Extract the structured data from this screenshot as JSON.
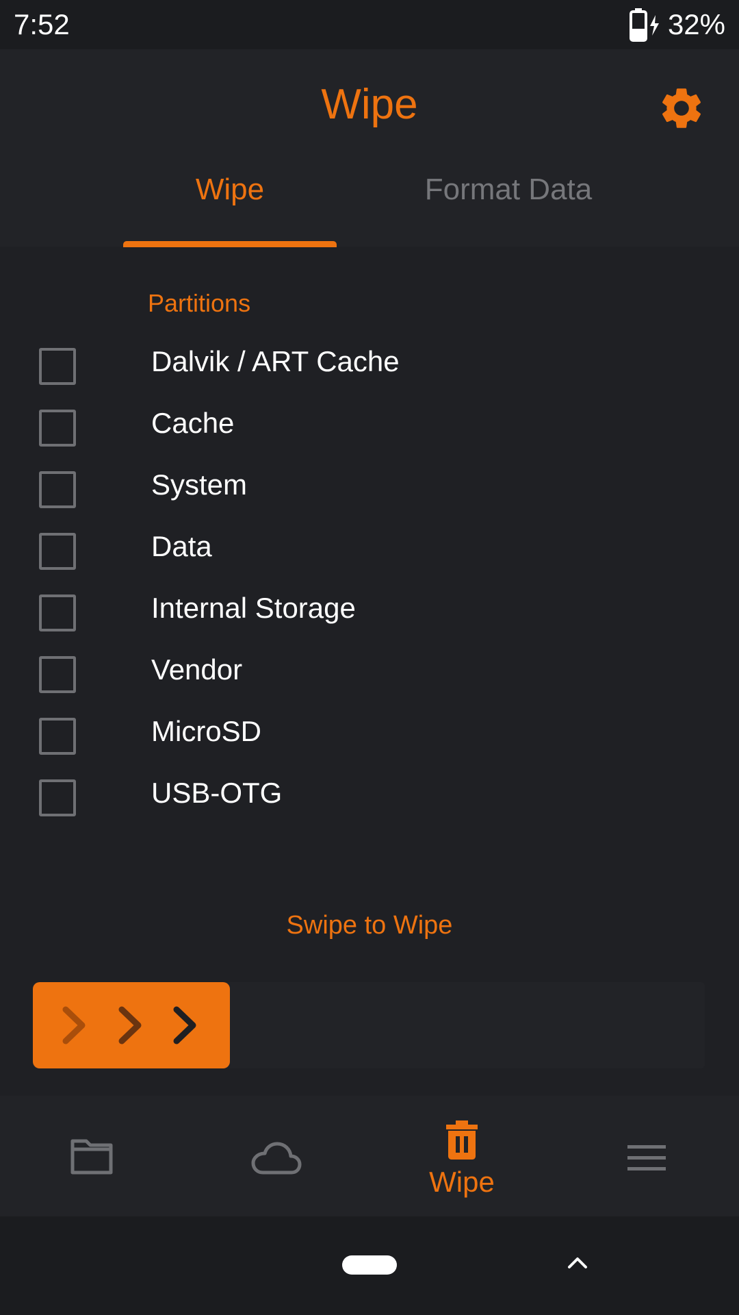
{
  "status_bar": {
    "time": "7:52",
    "battery_percent": "32%",
    "battery_icon": "battery-charging-icon"
  },
  "header": {
    "title": "Wipe",
    "settings_icon": "gear-icon"
  },
  "tabs": [
    {
      "label": "Wipe",
      "active": true
    },
    {
      "label": "Format Data",
      "active": false
    }
  ],
  "partitions": {
    "section_label": "Partitions",
    "items": [
      {
        "label": "Dalvik / ART Cache",
        "checked": false
      },
      {
        "label": "Cache",
        "checked": false
      },
      {
        "label": "System",
        "checked": false
      },
      {
        "label": "Data",
        "checked": false
      },
      {
        "label": "Internal Storage",
        "checked": false
      },
      {
        "label": "Vendor",
        "checked": false
      },
      {
        "label": "MicroSD",
        "checked": false
      },
      {
        "label": "USB-OTG",
        "checked": false
      }
    ]
  },
  "swipe": {
    "label": "Swipe to Wipe",
    "handle_icon": "triple-chevron-right-icon"
  },
  "bottom_nav": {
    "items": [
      {
        "icon": "folder-icon",
        "label": "",
        "active": false
      },
      {
        "icon": "cloud-icon",
        "label": "",
        "active": false
      },
      {
        "icon": "trash-icon",
        "label": "Wipe",
        "active": true
      },
      {
        "icon": "menu-icon",
        "label": "",
        "active": false
      }
    ]
  },
  "colors": {
    "accent": "#ee7310",
    "background": "#1f2024",
    "surface": "#222327",
    "inactive": "#76777b"
  }
}
